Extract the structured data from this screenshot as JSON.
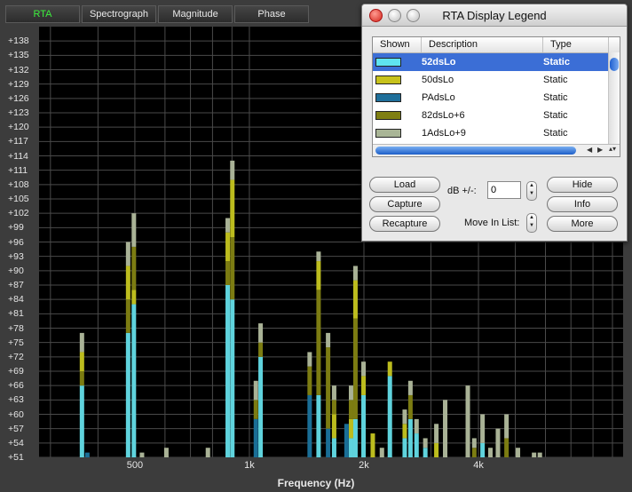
{
  "tabs": [
    {
      "label": "RTA",
      "active": true
    },
    {
      "label": "Spectrograph",
      "active": false
    },
    {
      "label": "Magnitude",
      "active": false
    },
    {
      "label": "Phase",
      "active": false
    }
  ],
  "plot": {
    "y_ticks": [
      "+138",
      "+135",
      "+132",
      "+129",
      "+126",
      "+123",
      "+120",
      "+117",
      "+114",
      "+111",
      "+108",
      "+105",
      "+102",
      "+99",
      "+96",
      "+93",
      "+90",
      "+87",
      "+84",
      "+81",
      "+78",
      "+75",
      "+72",
      "+69",
      "+66",
      "+63",
      "+60",
      "+57",
      "+54",
      "+51"
    ],
    "x_ticks": [
      {
        "label": "500",
        "hz": 500
      },
      {
        "label": "1k",
        "hz": 1000
      },
      {
        "label": "2k",
        "hz": 2000
      },
      {
        "label": "4k",
        "hz": 4000
      }
    ],
    "x_title": "Frequency (Hz)",
    "y_title": "",
    "colors": {
      "background": "#000000",
      "grid": "#4a4a4a"
    }
  },
  "chart_data": {
    "type": "bar",
    "xscale": "log",
    "xlim_hz": [
      280,
      9600
    ],
    "ylim": [
      51,
      141
    ],
    "xlabel": "Frequency (Hz)",
    "series_colors": {
      "52dsLo": "#5fd3dd",
      "50dsLo": "#bcbc1e",
      "PAdsLo": "#1a6e96",
      "82dsLo+6": "#7c7c12",
      "1AdsLo+9": "#a9b296"
    },
    "bars": [
      {
        "hz": 363,
        "levels": [
          [
            66,
            "52dsLo"
          ],
          [
            69,
            "82dsLo+6"
          ],
          [
            73,
            "50dsLo"
          ],
          [
            77,
            "1AdsLo+9"
          ]
        ]
      },
      {
        "hz": 375,
        "levels": [
          [
            52,
            "PAdsLo"
          ]
        ]
      },
      {
        "hz": 480,
        "levels": [
          [
            77,
            "52dsLo"
          ],
          [
            84,
            "82dsLo+6"
          ],
          [
            91,
            "50dsLo"
          ],
          [
            96,
            "1AdsLo+9"
          ]
        ]
      },
      {
        "hz": 497,
        "levels": [
          [
            83,
            "52dsLo"
          ],
          [
            86,
            "50dsLo"
          ],
          [
            95,
            "82dsLo+6"
          ],
          [
            102,
            "1AdsLo+9"
          ]
        ]
      },
      {
        "hz": 522,
        "levels": [
          [
            52,
            "1AdsLo+9"
          ]
        ]
      },
      {
        "hz": 605,
        "levels": [
          [
            53,
            "1AdsLo+9"
          ]
        ]
      },
      {
        "hz": 778,
        "levels": [
          [
            53,
            "1AdsLo+9"
          ]
        ]
      },
      {
        "hz": 877,
        "levels": [
          [
            87,
            "52dsLo"
          ],
          [
            92,
            "82dsLo+6"
          ],
          [
            98,
            "50dsLo"
          ],
          [
            101,
            "1AdsLo+9"
          ]
        ]
      },
      {
        "hz": 902,
        "levels": [
          [
            84,
            "52dsLo"
          ],
          [
            97,
            "82dsLo+6"
          ],
          [
            109,
            "50dsLo"
          ],
          [
            113,
            "1AdsLo+9"
          ]
        ]
      },
      {
        "hz": 1040,
        "levels": [
          [
            59,
            "PAdsLo"
          ],
          [
            63,
            "82dsLo+6"
          ],
          [
            67,
            "1AdsLo+9"
          ]
        ]
      },
      {
        "hz": 1070,
        "levels": [
          [
            72,
            "52dsLo"
          ],
          [
            75,
            "82dsLo+6"
          ],
          [
            79,
            "1AdsLo+9"
          ]
        ]
      },
      {
        "hz": 1440,
        "levels": [
          [
            64,
            "PAdsLo"
          ],
          [
            70,
            "82dsLo+6"
          ],
          [
            73,
            "1AdsLo+9"
          ]
        ]
      },
      {
        "hz": 1520,
        "levels": [
          [
            64,
            "52dsLo"
          ],
          [
            86,
            "82dsLo+6"
          ],
          [
            92,
            "50dsLo"
          ],
          [
            94,
            "1AdsLo+9"
          ]
        ]
      },
      {
        "hz": 1610,
        "levels": [
          [
            57,
            "PAdsLo"
          ],
          [
            74,
            "82dsLo+6"
          ],
          [
            77,
            "1AdsLo+9"
          ]
        ]
      },
      {
        "hz": 1670,
        "levels": [
          [
            55,
            "52dsLo"
          ],
          [
            60,
            "50dsLo"
          ],
          [
            63,
            "82dsLo+6"
          ],
          [
            66,
            "1AdsLo+9"
          ]
        ]
      },
      {
        "hz": 1800,
        "levels": [
          [
            58,
            "PAdsLo"
          ]
        ]
      },
      {
        "hz": 1850,
        "levels": [
          [
            55,
            "52dsLo"
          ],
          [
            59,
            "50dsLo"
          ],
          [
            63,
            "82dsLo+6"
          ],
          [
            66,
            "1AdsLo+9"
          ]
        ]
      },
      {
        "hz": 1900,
        "levels": [
          [
            59,
            "52dsLo"
          ],
          [
            80,
            "82dsLo+6"
          ],
          [
            88,
            "50dsLo"
          ],
          [
            91,
            "1AdsLo+9"
          ]
        ]
      },
      {
        "hz": 1995,
        "levels": [
          [
            64,
            "52dsLo"
          ],
          [
            68,
            "50dsLo"
          ],
          [
            71,
            "1AdsLo+9"
          ]
        ]
      },
      {
        "hz": 2110,
        "levels": [
          [
            56,
            "50dsLo"
          ]
        ]
      },
      {
        "hz": 2230,
        "levels": [
          [
            53,
            "1AdsLo+9"
          ]
        ]
      },
      {
        "hz": 2340,
        "levels": [
          [
            68,
            "52dsLo"
          ],
          [
            71,
            "50dsLo"
          ]
        ]
      },
      {
        "hz": 2560,
        "levels": [
          [
            55,
            "52dsLo"
          ],
          [
            58,
            "50dsLo"
          ],
          [
            61,
            "1AdsLo+9"
          ]
        ]
      },
      {
        "hz": 2650,
        "levels": [
          [
            59,
            "52dsLo"
          ],
          [
            64,
            "82dsLo+6"
          ],
          [
            67,
            "1AdsLo+9"
          ]
        ]
      },
      {
        "hz": 2750,
        "levels": [
          [
            56,
            "52dsLo"
          ],
          [
            59,
            "1AdsLo+9"
          ]
        ]
      },
      {
        "hz": 2900,
        "levels": [
          [
            53,
            "52dsLo"
          ],
          [
            55,
            "1AdsLo+9"
          ]
        ]
      },
      {
        "hz": 3100,
        "levels": [
          [
            54,
            "50dsLo"
          ],
          [
            58,
            "1AdsLo+9"
          ]
        ]
      },
      {
        "hz": 3270,
        "levels": [
          [
            63,
            "1AdsLo+9"
          ]
        ]
      },
      {
        "hz": 3750,
        "levels": [
          [
            66,
            "1AdsLo+9"
          ]
        ]
      },
      {
        "hz": 3900,
        "levels": [
          [
            53,
            "82dsLo+6"
          ],
          [
            55,
            "1AdsLo+9"
          ]
        ]
      },
      {
        "hz": 4100,
        "levels": [
          [
            54,
            "52dsLo"
          ],
          [
            60,
            "1AdsLo+9"
          ]
        ]
      },
      {
        "hz": 4300,
        "levels": [
          [
            53,
            "1AdsLo+9"
          ]
        ]
      },
      {
        "hz": 4500,
        "levels": [
          [
            57,
            "1AdsLo+9"
          ]
        ]
      },
      {
        "hz": 4740,
        "levels": [
          [
            55,
            "82dsLo+6"
          ],
          [
            60,
            "1AdsLo+9"
          ]
        ]
      },
      {
        "hz": 5080,
        "levels": [
          [
            53,
            "1AdsLo+9"
          ]
        ]
      },
      {
        "hz": 5600,
        "levels": [
          [
            52,
            "1AdsLo+9"
          ]
        ]
      },
      {
        "hz": 5800,
        "levels": [
          [
            52,
            "1AdsLo+9"
          ]
        ]
      }
    ]
  },
  "legend": {
    "title": "RTA Display Legend",
    "headers": {
      "shown": "Shown",
      "description": "Description",
      "type": "Type"
    },
    "rows": [
      {
        "description": "52dsLo",
        "type": "Static",
        "color": "#5fe3f0",
        "selected": true
      },
      {
        "description": "50dsLo",
        "type": "Static",
        "color": "#c7c21c",
        "selected": false
      },
      {
        "description": "PAdsLo",
        "type": "Static",
        "color": "#1f6f9a",
        "selected": false
      },
      {
        "description": "82dsLo+6",
        "type": "Static",
        "color": "#7f7f12",
        "selected": false
      },
      {
        "description": "1AdsLo+9",
        "type": "Static",
        "color": "#a9b596",
        "selected": false
      }
    ],
    "buttons": {
      "load": "Load",
      "capture": "Capture",
      "recapture": "Recapture",
      "hide": "Hide",
      "info": "Info",
      "more": "More"
    },
    "db_label": "dB +/-:",
    "db_value": "0",
    "move_label": "Move In List:"
  }
}
